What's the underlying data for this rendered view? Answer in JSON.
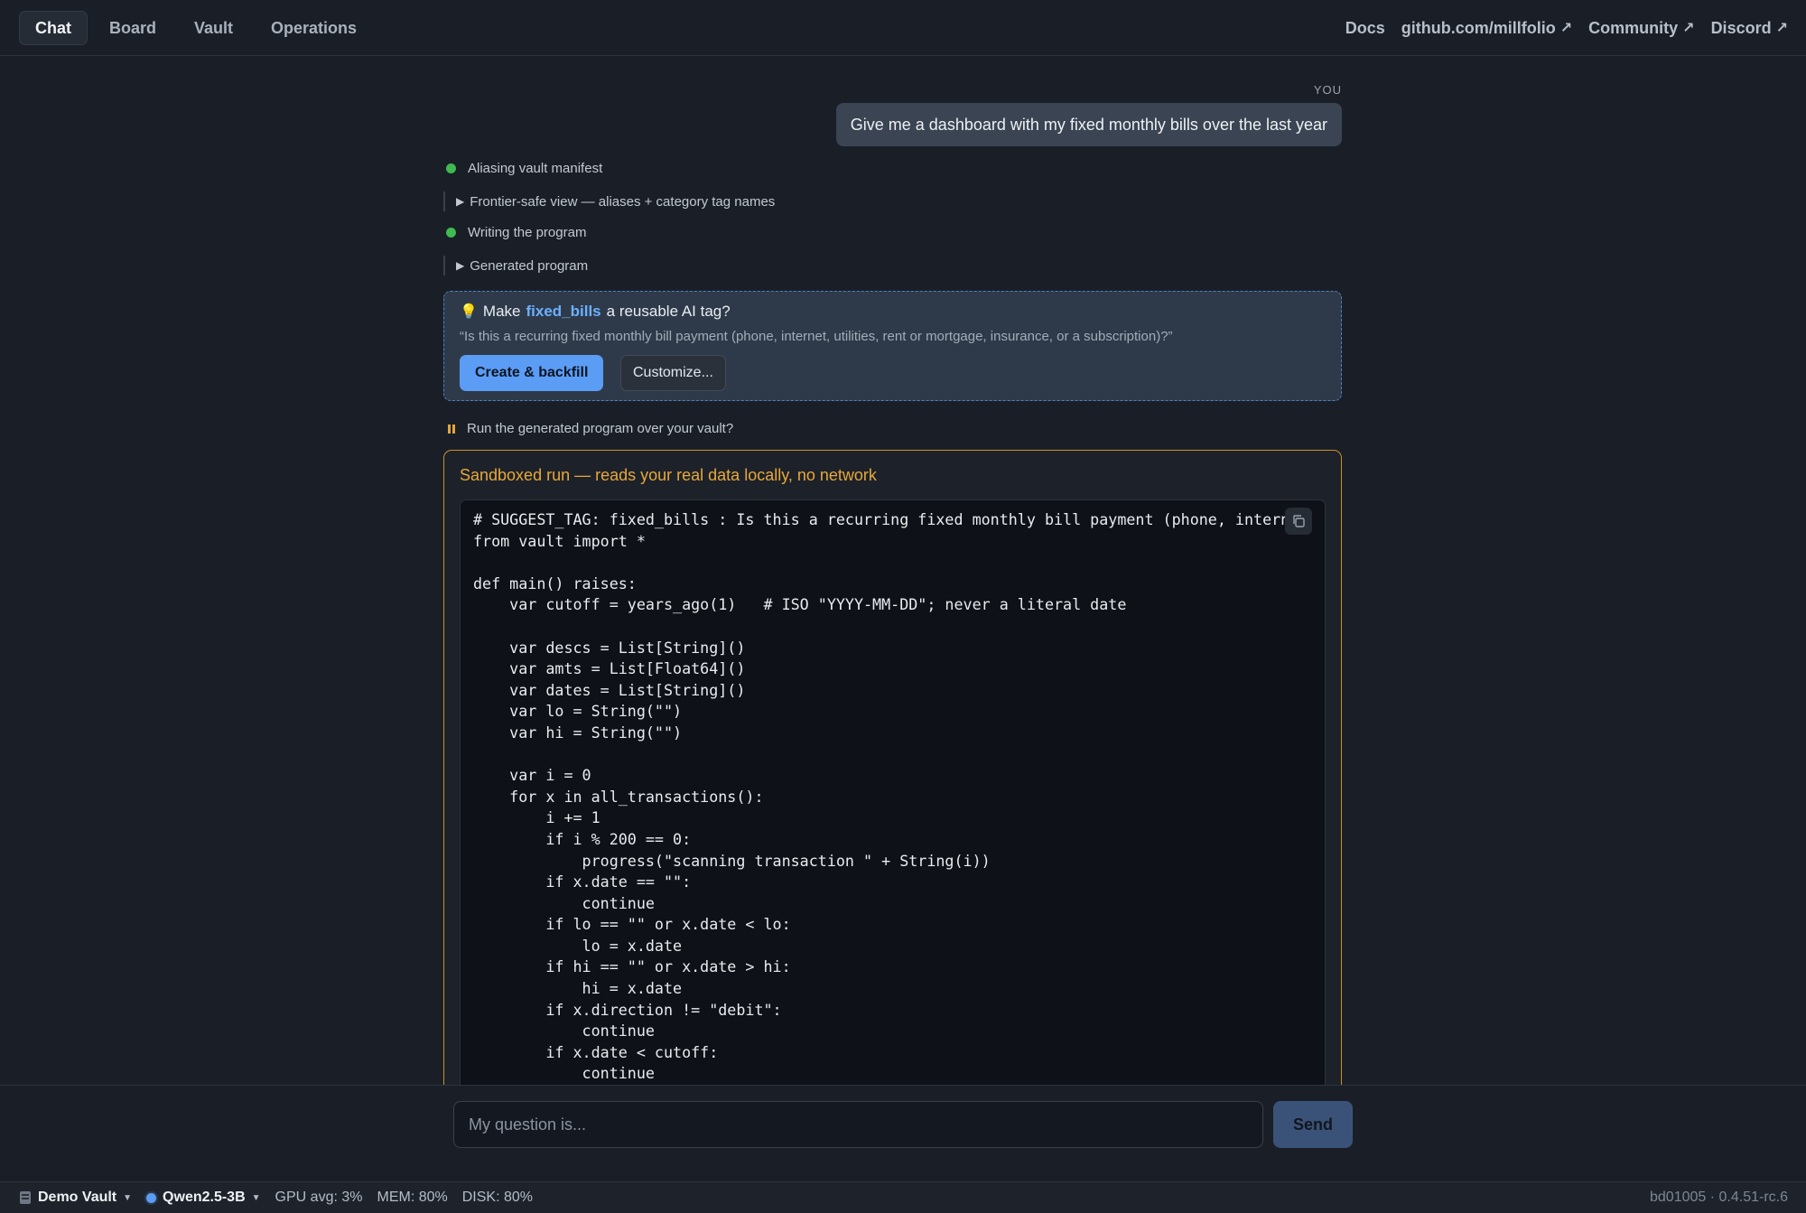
{
  "nav": {
    "tabs": [
      {
        "label": "Chat",
        "active": true
      },
      {
        "label": "Board",
        "active": false
      },
      {
        "label": "Vault",
        "active": false
      },
      {
        "label": "Operations",
        "active": false
      }
    ],
    "links": [
      {
        "label": "Docs",
        "external": false
      },
      {
        "label": "github.com/millfolio",
        "external": true
      },
      {
        "label": "Community",
        "external": true
      },
      {
        "label": "Discord",
        "external": true
      }
    ],
    "external_glyph": "↗"
  },
  "chat": {
    "you_label": "YOU",
    "user_message": "Give me a dashboard with my fixed monthly bills over the last year",
    "steps": [
      {
        "label": "Aliasing vault manifest",
        "status_color": "#3fb950"
      },
      {
        "label": "Frontier-safe view — aliases + category tag names",
        "collapsed": true
      },
      {
        "label": "Writing the program",
        "status_color": "#3fb950"
      },
      {
        "label": "Generated program",
        "collapsed": true
      }
    ],
    "suggestion": {
      "icon": "lightbulb-icon",
      "prefix": "Make",
      "tag_name": "fixed_bills",
      "suffix": "a reusable AI tag?",
      "question": "“Is this a recurring fixed monthly bill payment (phone, internet, utilities, rent or mortgage, insurance, or a subscription)?”",
      "primary_button": "Create & backfill",
      "secondary_button": "Customize..."
    },
    "pending": {
      "label": "Run the generated program over your vault?",
      "accent": "#e3a73b"
    },
    "sandbox": {
      "title": "Sandboxed run — reads your real data locally, no network",
      "code": "# SUGGEST_TAG: fixed_bills : Is this a recurring fixed monthly bill payment (phone, internet, utilities, rent or mortgage, insurance, or a subscription)?\nfrom vault import *\n\ndef main() raises:\n    var cutoff = years_ago(1)   # ISO \"YYYY-MM-DD\"; never a literal date\n\n    var descs = List[String]()\n    var amts = List[Float64]()\n    var dates = List[String]()\n    var lo = String(\"\")\n    var hi = String(\"\")\n\n    var i = 0\n    for x in all_transactions():\n        i += 1\n        if i % 200 == 0:\n            progress(\"scanning transaction \" + String(i))\n        if x.date == \"\":\n            continue\n        if lo == \"\" or x.date < lo:\n            lo = x.date\n        if hi == \"\" or x.date > hi:\n            hi = x.date\n        if x.direction != \"debit\":\n            continue\n        if x.date < cutoff:\n            continue"
    }
  },
  "composer": {
    "placeholder": "My question is...",
    "send_label": "Send"
  },
  "status": {
    "vault": "Demo Vault",
    "model": "Qwen2.5-3B",
    "gpu": "GPU avg: 3%",
    "mem": "MEM: 80%",
    "disk": "DISK: 80%",
    "build": "bd01005 · 0.4.51-rc.6"
  }
}
